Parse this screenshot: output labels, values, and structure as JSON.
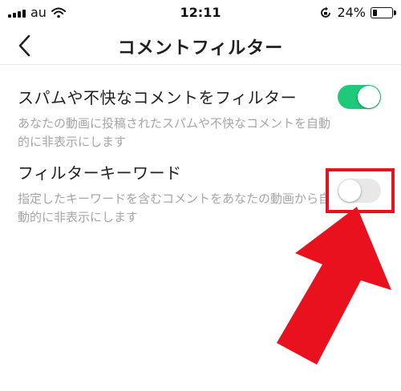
{
  "status_bar": {
    "carrier": "au",
    "time": "12:11",
    "battery_percent": "24%",
    "battery_level": 0.24
  },
  "nav": {
    "title": "コメントフィルター",
    "back_icon": "chevron-left-icon"
  },
  "settings": [
    {
      "title": "スパムや不快なコメントをフィルター",
      "description_line1": "あなたの動画に投稿されたスパムや不快なコメントを自動",
      "description_line2": "的に非表示にします",
      "enabled": true
    },
    {
      "title": "フィルターキーワード",
      "description_line1": "指定したキーワードを含むコメントをあなたの動画から自",
      "description_line2": "動的に非表示にします",
      "enabled": false
    }
  ],
  "colors": {
    "toggle_on": "#1ec97a",
    "toggle_off": "#e8e8e8",
    "annotation": "#e8111d"
  }
}
